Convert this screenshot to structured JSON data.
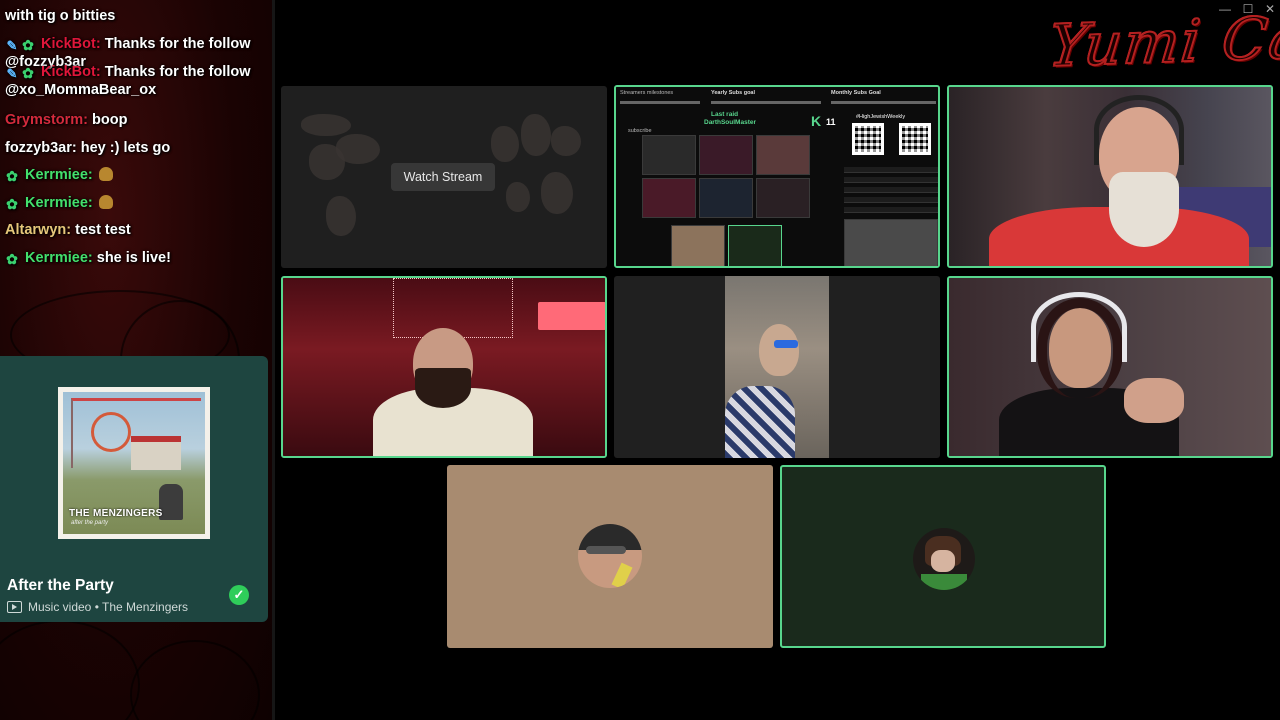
{
  "chat": {
    "messages": [
      {
        "author": "",
        "text": "with tig o bitties",
        "author_color": "#ffffff",
        "badges": []
      },
      {
        "author": "KickBot:",
        "text": "Thanks for the follow @fozzyb3ar",
        "author_color": "#e0163a",
        "badges": [
          "sword",
          "gear"
        ]
      },
      {
        "author": "KickBot:",
        "text": "Thanks for the follow @xo_MommaBear_ox",
        "author_color": "#e0163a",
        "badges": [
          "sword",
          "gear"
        ]
      },
      {
        "author": "Grymstorm:",
        "text": "boop",
        "author_color": "#d42a3c",
        "badges": []
      },
      {
        "author": "fozzyb3ar:",
        "text": "hey :) lets go",
        "author_color": "#ffffff",
        "badges": []
      },
      {
        "author": "Kerrmiee:",
        "text": "",
        "author_color": "#43e06c",
        "badges": [
          "gear"
        ],
        "emote": true
      },
      {
        "author": "Kerrmiee:",
        "text": "",
        "author_color": "#43e06c",
        "badges": [
          "gear"
        ],
        "emote": true
      },
      {
        "author": "Altarwyn:",
        "text": "test test",
        "author_color": "#e6c77a",
        "badges": []
      },
      {
        "author": "Kerrmiee:",
        "text": "she is live!",
        "author_color": "#43e06c",
        "badges": [
          "gear"
        ]
      }
    ]
  },
  "media": {
    "track_title": "After the Party",
    "meta": "Music video • The Menzingers",
    "album_label": "THE MENZINGERS",
    "album_sub": "after the party",
    "check_icon": "check-circle-icon"
  },
  "tiles": {
    "watch_stream_label": "Watch Stream",
    "mini": {
      "header_left": "Streamers milestones",
      "yearly_goal": "Yearly Subs goal",
      "monthly_goal": "Monthly Subs Goal",
      "last_raid_label": "Last raid",
      "last_raid_name": "DarthSoulMaster",
      "k_count": "11",
      "handle": "#HighJewishWeekly",
      "subscribe_label": "subscribe"
    }
  },
  "logo": {
    "text": "Yumi Cat"
  },
  "window": {
    "minimize": "—",
    "maximize": "☐",
    "close": "✕"
  },
  "colors": {
    "active_border": "#58d68d",
    "card_bg": "#1e4540"
  }
}
